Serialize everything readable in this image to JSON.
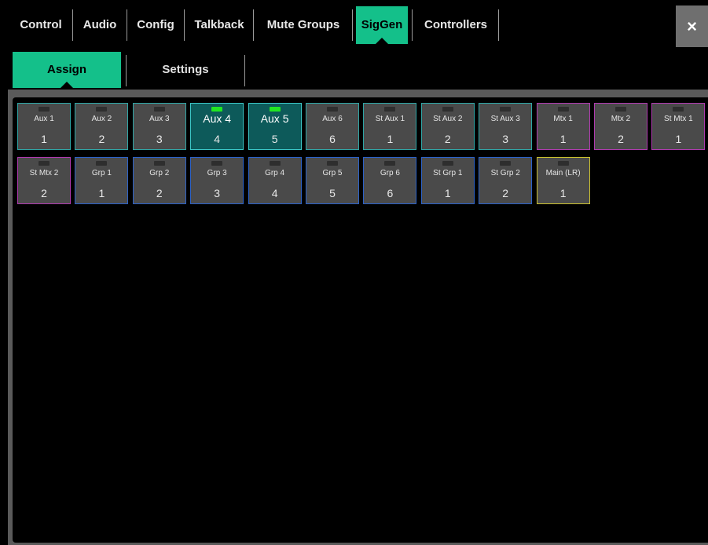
{
  "top_tabs": [
    {
      "label": "Control",
      "active": false
    },
    {
      "label": "Audio",
      "active": false
    },
    {
      "label": "Config",
      "active": false
    },
    {
      "label": "Talkback",
      "active": false
    },
    {
      "label": "Mute Groups",
      "active": false
    },
    {
      "label": "SigGen",
      "active": true
    },
    {
      "label": "Controllers",
      "active": false
    }
  ],
  "close_label": "×",
  "sub_tabs": [
    {
      "label": "Assign",
      "active": true
    },
    {
      "label": "Settings",
      "active": false
    }
  ],
  "colors": {
    "accent": "#14c08a",
    "aux_border": "#2ea6a6",
    "mtx_border": "#b03ab0",
    "grp_border": "#2c62c9",
    "main_border": "#c9c030",
    "led_on": "#22e622"
  },
  "buses": [
    {
      "name": "Aux 1",
      "number": "1",
      "type": "aux",
      "selected": false
    },
    {
      "name": "Aux 2",
      "number": "2",
      "type": "aux",
      "selected": false
    },
    {
      "name": "Aux 3",
      "number": "3",
      "type": "aux",
      "selected": false
    },
    {
      "name": "Aux 4",
      "number": "4",
      "type": "aux",
      "selected": true
    },
    {
      "name": "Aux 5",
      "number": "5",
      "type": "aux",
      "selected": true
    },
    {
      "name": "Aux 6",
      "number": "6",
      "type": "aux",
      "selected": false
    },
    {
      "name": "St Aux 1",
      "number": "1",
      "type": "stx",
      "selected": false
    },
    {
      "name": "St Aux 2",
      "number": "2",
      "type": "stx",
      "selected": false
    },
    {
      "name": "St Aux 3",
      "number": "3",
      "type": "stx",
      "selected": false
    },
    {
      "name": "Mtx 1",
      "number": "1",
      "type": "mtx",
      "selected": false
    },
    {
      "name": "Mtx 2",
      "number": "2",
      "type": "mtx",
      "selected": false
    },
    {
      "name": "St Mtx 1",
      "number": "1",
      "type": "mtx",
      "selected": false
    },
    {
      "name": "St Mtx 2",
      "number": "2",
      "type": "mtx",
      "selected": false
    },
    {
      "name": "Grp 1",
      "number": "1",
      "type": "grp",
      "selected": false
    },
    {
      "name": "Grp 2",
      "number": "2",
      "type": "grp",
      "selected": false
    },
    {
      "name": "Grp 3",
      "number": "3",
      "type": "grp",
      "selected": false
    },
    {
      "name": "Grp 4",
      "number": "4",
      "type": "grp",
      "selected": false
    },
    {
      "name": "Grp 5",
      "number": "5",
      "type": "grp",
      "selected": false
    },
    {
      "name": "Grp 6",
      "number": "6",
      "type": "grp",
      "selected": false
    },
    {
      "name": "St Grp 1",
      "number": "1",
      "type": "grp",
      "selected": false
    },
    {
      "name": "St Grp 2",
      "number": "2",
      "type": "grp",
      "selected": false
    },
    {
      "name": "Main (LR)",
      "number": "1",
      "type": "main",
      "selected": false
    }
  ]
}
